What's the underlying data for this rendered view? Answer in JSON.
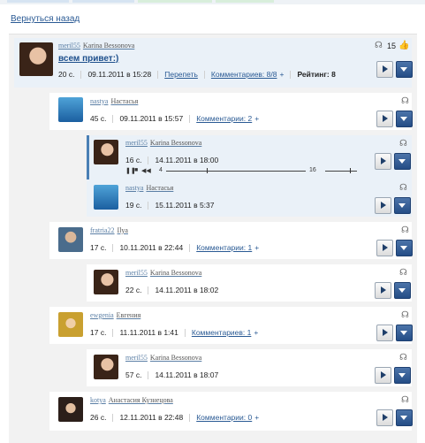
{
  "back_link": "Вернуться назад",
  "colors": {
    "link": "#2a5a94",
    "accent": "#4a7fb5",
    "highlight": "#eaf1f8"
  },
  "post": {
    "nick": "meril55",
    "name": "Karina Bessonova",
    "title": "всем привет:)",
    "duration": "20 с.",
    "date": "09.11.2011 в 15:28",
    "reply_label": "Перепеть",
    "comments_label": "Комментариев: 8/8",
    "plus": "+",
    "rating": "Рейтинг: 8",
    "likes": "15"
  },
  "comments": [
    {
      "nick": "nastya",
      "name": "Настасья",
      "duration": "45 с.",
      "date": "09.11.2011 в 15:57",
      "comments": "Комментарии: 2",
      "plus": "+"
    },
    {
      "nick": "meril55",
      "name": "Karina Bessonova",
      "duration": "16 с.",
      "date": "14.11.2011 в 18:00",
      "player_start": "4",
      "player_end": "16"
    },
    {
      "nick": "nastya",
      "name": "Настасья",
      "duration": "19 с.",
      "date": "15.11.2011 в 5:37"
    },
    {
      "nick": "fratria22",
      "name": "Ilya",
      "duration": "17 с.",
      "date": "10.11.2011 в 22:44",
      "comments": "Комментарии: 1",
      "plus": "+"
    },
    {
      "nick": "meril55",
      "name": "Karina Bessonova",
      "duration": "22 с.",
      "date": "14.11.2011 в 18:02"
    },
    {
      "nick": "ewgenia",
      "name": "Евгения",
      "duration": "17 с.",
      "date": "11.11.2011 в 1:41",
      "comments": "Комментариев: 1",
      "plus": "+"
    },
    {
      "nick": "meril55",
      "name": "Karina Bessonova",
      "duration": "57 с.",
      "date": "14.11.2011 в 18:07"
    },
    {
      "nick": "kotya",
      "name": "Анастасия Кузнецова",
      "duration": "26 с.",
      "date": "12.11.2011 в 22:48",
      "comments": "Комментарии: 0",
      "plus": "+"
    }
  ]
}
